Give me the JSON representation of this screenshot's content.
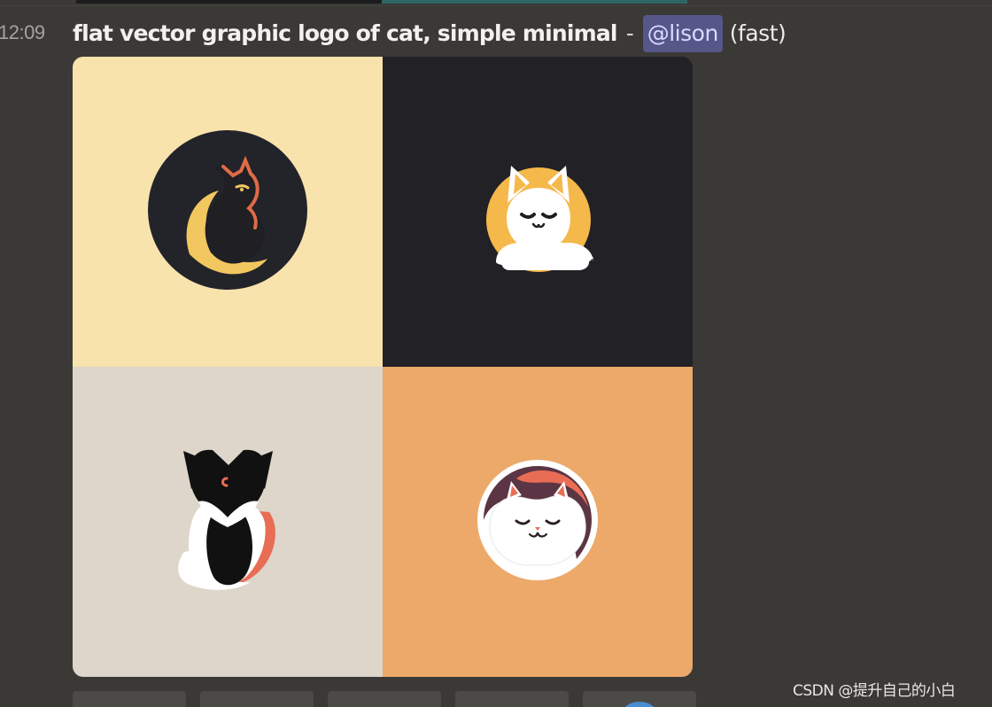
{
  "message": {
    "timestamp": "12:09",
    "prompt": "flat vector graphic logo of cat, simple minimal",
    "separator": "-",
    "mention": "@lison",
    "speed": "(fast)"
  },
  "images": [
    {
      "name": "cat-logo-1",
      "background": "#f8e3ad"
    },
    {
      "name": "cat-logo-2",
      "background": "#222126"
    },
    {
      "name": "cat-logo-3",
      "background": "#ded5cb"
    },
    {
      "name": "cat-logo-4",
      "background": "#eca96a"
    }
  ],
  "buttons": [
    {
      "name": "action-button-1",
      "label": ""
    },
    {
      "name": "action-button-2",
      "label": ""
    },
    {
      "name": "action-button-3",
      "label": ""
    },
    {
      "name": "action-button-4",
      "label": ""
    },
    {
      "name": "action-button-5",
      "icon": "reroll-icon"
    }
  ],
  "watermark": "CSDN @提升自己的小白",
  "colors": {
    "app_background": "#3a3936",
    "mention_background": "#555789",
    "mention_text": "#d7dbff",
    "timestamp": "#a5a39f",
    "button_background": "#4b4a47"
  }
}
